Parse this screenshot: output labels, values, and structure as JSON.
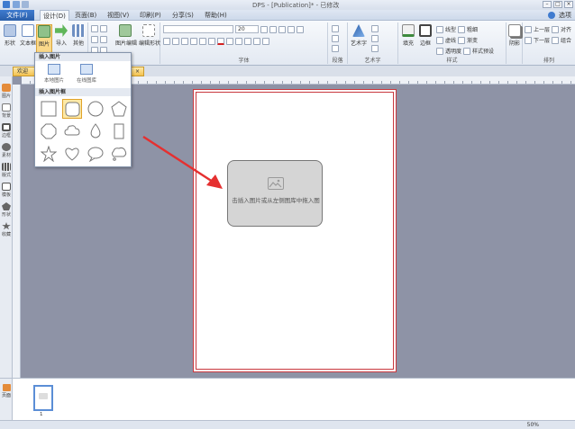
{
  "titlebar": {
    "title": "DPS - [Publication]* - 已修改"
  },
  "window_controls": {
    "minimize": "–",
    "maximize": "□",
    "close": "×"
  },
  "menu": {
    "file": "文件(F)",
    "tabs": [
      "设计(D)",
      "页面(B)",
      "视图(V)",
      "印刷(P)",
      "分享(S)",
      "帮助(H)"
    ],
    "options": "选项"
  },
  "ribbon": {
    "shape": "形状",
    "textbox": "文本框",
    "image": "图片",
    "import": "导入",
    "other": "其他",
    "image_edit": "图片编辑",
    "edit_shape": "编辑形状",
    "font_size": "20",
    "font_group_label": "字体",
    "paragraph_label": "段落",
    "arttext": "艺术字",
    "arttext_label": "艺术字",
    "fill": "填充",
    "border": "边框",
    "style_label": "样式",
    "shadow": "阴影",
    "arrange_label": "排列",
    "arrange_items": [
      "上一层",
      "下一层",
      "对齐",
      "组合"
    ],
    "style_items": [
      "线型",
      "粗细",
      "虚线",
      "渐变",
      "透明度",
      "样式预设"
    ]
  },
  "doc_tab": {
    "label": "欢迎",
    "close": "×"
  },
  "left_panel": [
    "图片",
    "背景",
    "边框",
    "素材",
    "版式",
    "模板",
    "形状",
    "收藏"
  ],
  "dropdown": {
    "insert_header": "插入图片",
    "local": "本地图片",
    "online": "在线图库",
    "frame_header": "插入图片框"
  },
  "canvas": {
    "frame_hint": "击插入图片或从左侧图库中拖入图"
  },
  "bottom": {
    "pages_tab": "页面",
    "thumbnail_number": "1"
  },
  "status": {
    "zoom": "50%"
  },
  "colors": {
    "accent": "#2a5ea9",
    "arrow": "#e53030",
    "page_border": "#c9383e",
    "selected_shape": "#fde9a6"
  }
}
